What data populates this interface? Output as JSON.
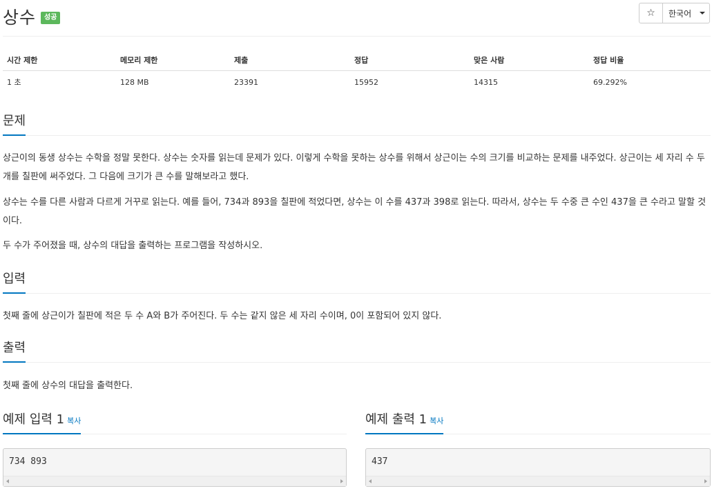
{
  "header": {
    "title": "상수",
    "result_badge": "성공",
    "star_icon": "☆",
    "language": "한국어"
  },
  "stats": {
    "headers": [
      "시간 제한",
      "메모리 제한",
      "제출",
      "정답",
      "맞은 사람",
      "정답 비율"
    ],
    "values": [
      "1 초",
      "128 MB",
      "23391",
      "15952",
      "14315",
      "69.292%"
    ]
  },
  "sections": {
    "problem": {
      "heading": "문제",
      "paragraphs": [
        "상근이의 동생 상수는 수학을 정말 못한다. 상수는 숫자를 읽는데 문제가 있다. 이렇게 수학을 못하는 상수를 위해서 상근이는 수의 크기를 비교하는 문제를 내주었다. 상근이는 세 자리 수 두 개를 칠판에 써주었다. 그 다음에 크기가 큰 수를 말해보라고 했다.",
        "상수는 수를 다른 사람과 다르게 거꾸로 읽는다. 예를 들어, 734과 893을 칠판에 적었다면, 상수는 이 수를 437과 398로 읽는다. 따라서, 상수는 두 수중 큰 수인 437을 큰 수라고 말할 것이다.",
        "두 수가 주어졌을 때, 상수의 대답을 출력하는 프로그램을 작성하시오."
      ]
    },
    "input": {
      "heading": "입력",
      "text": "첫째 줄에 상근이가 칠판에 적은 두 수 A와 B가 주어진다. 두 수는 같지 않은 세 자리 수이며, 0이 포함되어 있지 않다."
    },
    "output": {
      "heading": "출력",
      "text": "첫째 줄에 상수의 대답을 출력한다."
    }
  },
  "examples": {
    "input": {
      "heading": "예제 입력 1",
      "copy_label": "복사",
      "content": "734 893"
    },
    "output": {
      "heading": "예제 출력 1",
      "copy_label": "복사",
      "content": "437"
    }
  },
  "colors": {
    "accent": "#0076c0",
    "success": "#5cb85c",
    "border": "#eeeeee"
  }
}
